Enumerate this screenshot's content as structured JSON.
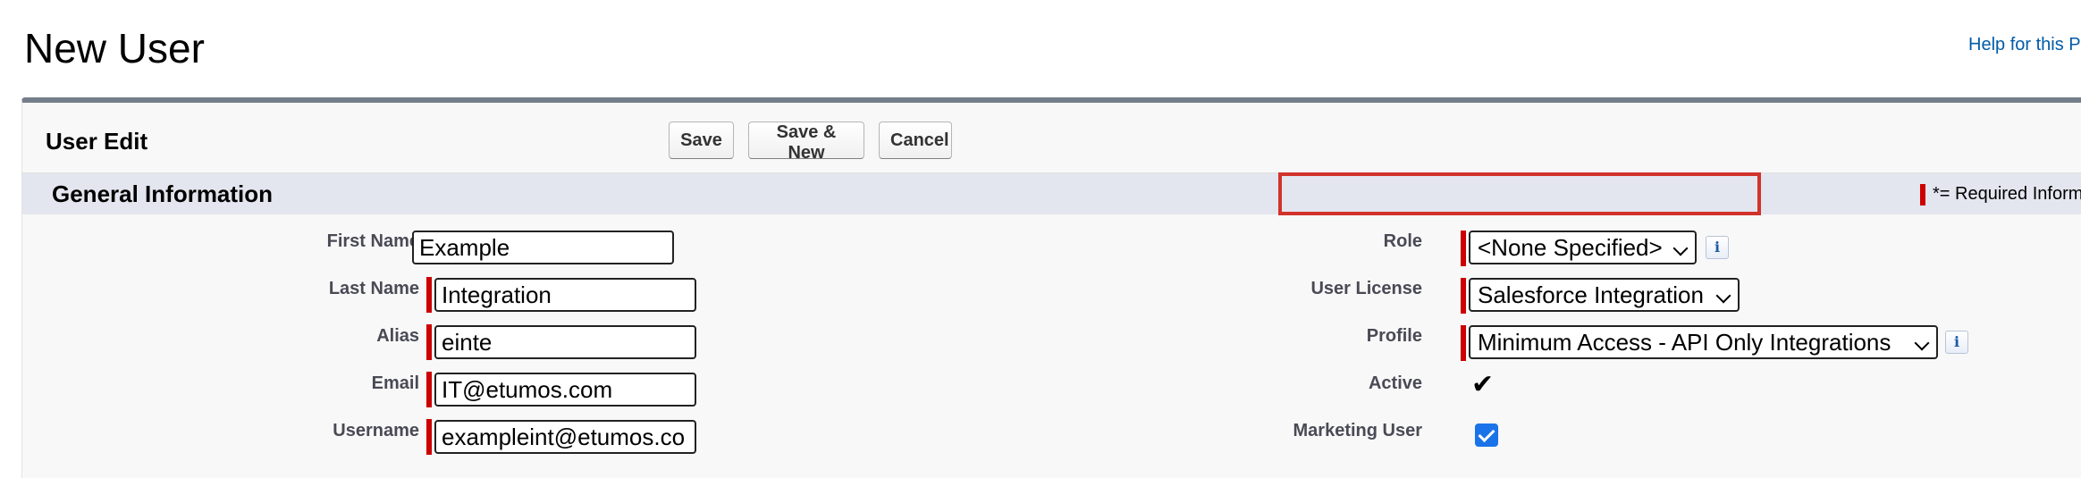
{
  "page": {
    "title": "New User",
    "help_link": "Help for this P"
  },
  "panel": {
    "title": "User Edit",
    "buttons": {
      "save": "Save",
      "save_new": "Save & New",
      "cancel": "Cancel"
    }
  },
  "section": {
    "title": "General Information",
    "required_legend": "*= Required Inform"
  },
  "left_fields": [
    {
      "label": "First Name",
      "value": "Example",
      "required": false
    },
    {
      "label": "Last Name",
      "value": "Integration",
      "required": true
    },
    {
      "label": "Alias",
      "value": "einte",
      "required": true
    },
    {
      "label": "Email",
      "value": "IT@etumos.com",
      "required": true
    },
    {
      "label": "Username",
      "value": "exampleint@etumos.co",
      "required": true
    }
  ],
  "right_fields": {
    "role": {
      "label": "Role",
      "value": "<None Specified>",
      "info_icon": "info-icon"
    },
    "user_license": {
      "label": "User License",
      "value": "Salesforce Integration"
    },
    "profile": {
      "label": "Profile",
      "value": "Minimum Access - API Only Integrations",
      "info_icon": "info-icon"
    },
    "active": {
      "label": "Active",
      "checked": true
    },
    "marketing_user": {
      "label": "Marketing User",
      "checked": true
    }
  },
  "colors": {
    "required": "#cc0000",
    "highlight": "#d1332b",
    "link": "#015ba7",
    "checkbox": "#1a73e8",
    "section_bar": "#e3e6ee",
    "panel_border": "#747e8b"
  }
}
